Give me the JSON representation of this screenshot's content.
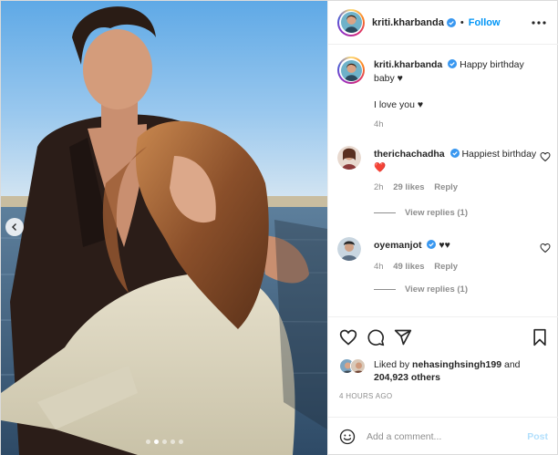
{
  "post": {
    "author": "kriti.kharbanda",
    "follow_label": "Follow",
    "separator": "•",
    "caption": {
      "username": "kriti.kharbanda",
      "text": "Happy birthday baby ♥",
      "line2": "I love you ♥",
      "time": "4h"
    },
    "comments": [
      {
        "username": "therichachadha",
        "text": "Happiest birthday",
        "emoji": "❤️",
        "time": "2h",
        "likes": "29 likes",
        "reply_label": "Reply",
        "view_replies": "View replies (1)"
      },
      {
        "username": "oyemanjot",
        "text": "♥♥",
        "time": "4h",
        "likes": "49 likes",
        "reply_label": "Reply",
        "view_replies": "View replies (1)"
      }
    ],
    "likes": {
      "prefix": "Liked by",
      "user": "nehasinghsingh199",
      "and": "and",
      "count": "204,923 others"
    },
    "date": "4 HOURS AGO",
    "composer": {
      "placeholder": "Add a comment...",
      "post_label": "Post"
    },
    "icons": {
      "more": "more-icon",
      "like": "heart-icon",
      "comment": "comment-icon",
      "share": "share-icon",
      "save": "bookmark-icon",
      "emoji": "emoji-icon",
      "prev": "chevron-left-icon",
      "verified": "verified-badge-icon"
    },
    "colors": {
      "accent": "#0095f6",
      "post_disabled": "#b2dffc",
      "muted": "#8e8e8e",
      "heart_red": "#ed4956"
    },
    "carousel": {
      "count": 5,
      "active": 2
    }
  }
}
